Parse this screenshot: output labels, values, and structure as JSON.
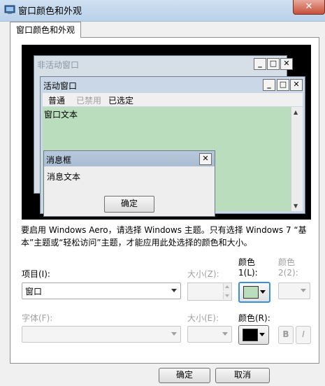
{
  "window": {
    "title": "窗口颜色和外观",
    "close_glyph": "✕"
  },
  "tab": {
    "label": "窗口颜色和外观"
  },
  "preview": {
    "inactive_title": "非活动窗口",
    "active_title": "活动窗口",
    "controls": {
      "minimize": "_",
      "maximize": "□",
      "close": "✕"
    },
    "menu": {
      "normal": "普通",
      "disabled": "已禁用",
      "selected": "已选定"
    },
    "window_text": "窗口文本",
    "msgbox": {
      "title": "消息框",
      "text": "消息文本",
      "ok": "确定"
    }
  },
  "description": "要启用 Windows Aero，请选择 Windows 主题。只有选择 Windows 7 “基本”主题或“轻松访问”主题，才能应用此处选择的颜色和大小。",
  "form": {
    "item_label": "项目(I):",
    "item_value": "窗口",
    "size_label": "大小(Z):",
    "color1_line1": "颜色",
    "color1_line2": "1(L):",
    "color2_line1": "颜色",
    "color2_line2": "2(2):",
    "font_label": "字体(F):",
    "font_size_label": "大小(E):",
    "font_color_label": "颜色(R):",
    "bold": "B",
    "italic": "I",
    "color1_hex": "#b9ddbd",
    "font_color_hex": "#000000"
  },
  "buttons": {
    "ok": "确定",
    "cancel": "取消"
  }
}
